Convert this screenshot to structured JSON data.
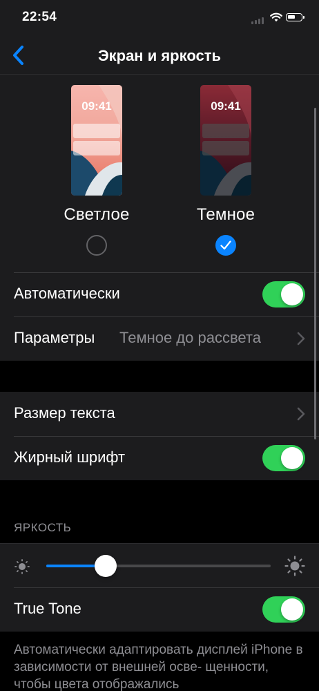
{
  "status_bar": {
    "time": "22:54"
  },
  "nav": {
    "title": "Экран и яркость",
    "back_icon": "chevron-left-icon"
  },
  "appearance": {
    "light": {
      "label": "Светлое",
      "preview_time": "09:41",
      "selected": false
    },
    "dark": {
      "label": "Темное",
      "preview_time": "09:41",
      "selected": true
    }
  },
  "rows": {
    "automatic": {
      "label": "Автоматически",
      "toggle_on": true
    },
    "options": {
      "label": "Параметры",
      "value": "Темное до рассвета"
    },
    "text_size": {
      "label": "Размер текста"
    },
    "bold_text": {
      "label": "Жирный шрифт",
      "toggle_on": true
    }
  },
  "brightness": {
    "header": "ЯРКОСТЬ",
    "level": 0.265,
    "true_tone": {
      "label": "True Tone",
      "toggle_on": true
    },
    "footer": "Автоматически адаптировать дисплей iPhone в зависимости от внешней осве- щенности, чтобы цвета отображались"
  },
  "colors": {
    "accent": "#0a84ff",
    "toggle_on": "#30d158",
    "background": "#000000",
    "cell": "#1c1c1e",
    "secondary_text": "#8e8e93"
  }
}
